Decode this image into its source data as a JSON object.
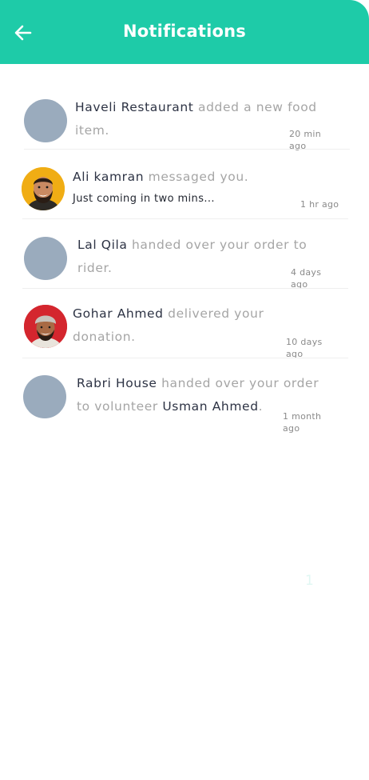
{
  "header": {
    "title": "Notifications",
    "back_icon": "arrow-left-icon",
    "color": "#1ecba8"
  },
  "notifications": [
    {
      "avatar": "placeholder",
      "name": "Haveli Restaurant",
      "text_before": " added a new food item.",
      "name2": "",
      "text_after": "",
      "subtext": "",
      "time": "20 min ago"
    },
    {
      "avatar": "man-beard-photo",
      "name": "Ali kamran",
      "text_before": " messaged you.",
      "name2": "",
      "text_after": "",
      "subtext": "Just coming in two mins...",
      "time": "1 hr ago"
    },
    {
      "avatar": "placeholder",
      "name": "Lal Qila",
      "text_before": " handed over your order to rider.",
      "name2": "",
      "text_after": "",
      "subtext": "",
      "time": "4 days ago"
    },
    {
      "avatar": "man-beanie-photo",
      "name": "Gohar Ahmed",
      "text_before": " delivered your donation.",
      "name2": "",
      "text_after": "",
      "subtext": "",
      "time": "10 days ago"
    },
    {
      "avatar": "placeholder",
      "name": "Rabri House",
      "text_before": " handed over your order to volunteer ",
      "name2": "Usman Ahmed",
      "text_after": ".",
      "subtext": "",
      "time": "1 month ago"
    }
  ],
  "stray_mark": "1"
}
